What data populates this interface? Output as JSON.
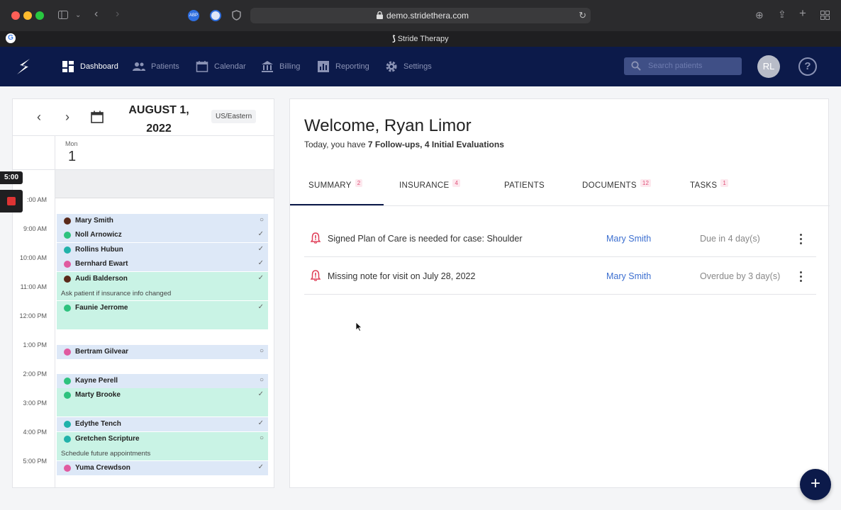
{
  "browser": {
    "url": "demo.stridethera.com",
    "tab_title": "Stride Therapy",
    "google_letter": "G"
  },
  "nav": {
    "items": [
      {
        "label": "Dashboard",
        "icon": "dashboard-icon",
        "active": true
      },
      {
        "label": "Patients",
        "icon": "patients-icon",
        "active": false
      },
      {
        "label": "Calendar",
        "icon": "calendar-icon",
        "active": false
      },
      {
        "label": "Billing",
        "icon": "billing-icon",
        "active": false
      },
      {
        "label": "Reporting",
        "icon": "reporting-icon",
        "active": false
      },
      {
        "label": "Settings",
        "icon": "settings-icon",
        "active": false
      }
    ],
    "search_placeholder": "Search patients",
    "avatar_initials": "RL",
    "help_glyph": "?"
  },
  "calendar": {
    "date_line1": "AUGUST 1,",
    "date_line2": "2022",
    "timezone": "US/Eastern",
    "day_of_week": "Mon",
    "day_number": "1",
    "hours": [
      "9:00 AM",
      "10:00 AM",
      "11:00 AM",
      "12:00 PM",
      "1:00 PM",
      "2:00 PM",
      "3:00 PM",
      "4:00 PM",
      "5:00 PM"
    ],
    "partial_hour": ":00 AM",
    "appointments": [
      {
        "name": "Mary Smith",
        "dot": "#5a2a1a",
        "status": "○"
      },
      {
        "name": "Noll Arnowicz",
        "dot": "#2ec27e",
        "status": "✓"
      },
      {
        "name": "Rollins Hubun",
        "dot": "#20b2aa",
        "status": "✓"
      },
      {
        "name": "Bernhard Ewart",
        "dot": "#e05aa0",
        "status": "✓"
      },
      {
        "name": "Audi Balderson",
        "dot": "#5a2a1a",
        "status": "✓",
        "note": "Ask patient if insurance info changed"
      },
      {
        "name": "Faunie Jerrome",
        "dot": "#2ec27e",
        "status": "✓"
      },
      {
        "name": "Bertram Gilvear",
        "dot": "#e05aa0",
        "status": "○"
      },
      {
        "name": "Kayne Perell",
        "dot": "#2ec27e",
        "status": "○"
      },
      {
        "name": "Marty Brooke",
        "dot": "#2ec27e",
        "status": "✓"
      },
      {
        "name": "Edythe Tench",
        "dot": "#20b2aa",
        "status": "✓"
      },
      {
        "name": "Gretchen Scripture",
        "dot": "#20b2aa",
        "status": "○",
        "note": "Schedule future appointments"
      },
      {
        "name": "Yuma Crewdson",
        "dot": "#e05aa0",
        "status": "✓"
      }
    ]
  },
  "overlay": {
    "clock": "5:00"
  },
  "main": {
    "welcome": "Welcome, Ryan Limor",
    "today_prefix": "Today, you have ",
    "today_bold": "7 Follow-ups, 4 Initial Evaluations",
    "tabs": [
      {
        "label": "SUMMARY",
        "badge": "2"
      },
      {
        "label": "INSURANCE",
        "badge": "4"
      },
      {
        "label": "PATIENTS",
        "badge": ""
      },
      {
        "label": "DOCUMENTS",
        "badge": "12"
      },
      {
        "label": "TASKS",
        "badge": "1"
      }
    ],
    "tasks": [
      {
        "desc": "Signed Plan of Care is needed for case: Shoulder",
        "who": "Mary Smith",
        "due": "Due in 4 day(s)"
      },
      {
        "desc": "Missing note for visit on July 28, 2022",
        "who": "Mary Smith",
        "due": "Overdue by 3 day(s)"
      }
    ]
  },
  "fab_label": "+",
  "colors": {
    "nav_bg": "#0c1a4a",
    "link": "#3c6fd0",
    "alert": "#e0415a",
    "appt_blue": "#dde8f7",
    "appt_green": "#c9f3e5"
  }
}
